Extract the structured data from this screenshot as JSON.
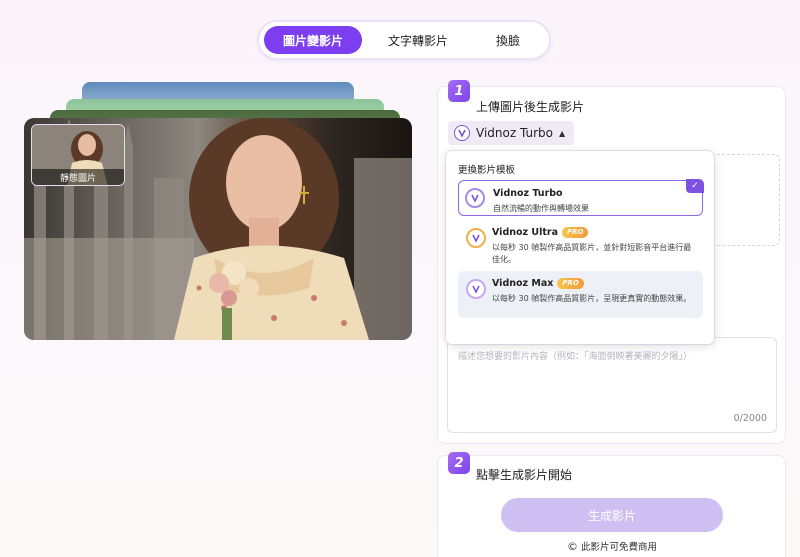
{
  "tabs": [
    {
      "label": "圖片變影片",
      "active": true
    },
    {
      "label": "文字轉影片",
      "active": false
    },
    {
      "label": "換臉",
      "active": false
    }
  ],
  "preview": {
    "thumb_label": "靜態圖片"
  },
  "step1": {
    "number": "1",
    "title": "上傳圖片後生成影片",
    "model_select": "Vidnoz Turbo"
  },
  "dropdown": {
    "title": "更換影片模板",
    "options": [
      {
        "name": "Vidnoz Turbo",
        "desc": "自然流暢的動作與轉場效果",
        "pro": false,
        "selected": true
      },
      {
        "name": "Vidnoz Ultra",
        "desc": "以每秒 30 幀製作高品質影片，並針對短影音平台進行最佳化。",
        "pro": true,
        "selected": false
      },
      {
        "name": "Vidnoz Max",
        "desc": "以每秒 30 幀製作高品質影片，呈現更真實的動態效果。",
        "pro": true,
        "selected": false
      }
    ],
    "pro_label": "PRO",
    "check_mark": "✓"
  },
  "prompt": {
    "placeholder": "描述您想要的影片內容（例如：「海面倒映著美麗的夕陽」）",
    "counter": "0/2000"
  },
  "step2": {
    "number": "2",
    "title": "點擊生成影片開始",
    "button": "生成影片",
    "note": "此影片可免費商用"
  },
  "colors": {
    "accent": "#7d3df0",
    "button_disabled": "#cfc0f3",
    "pro_gradient_start": "#f6c54b",
    "pro_gradient_end": "#f29a3a"
  }
}
